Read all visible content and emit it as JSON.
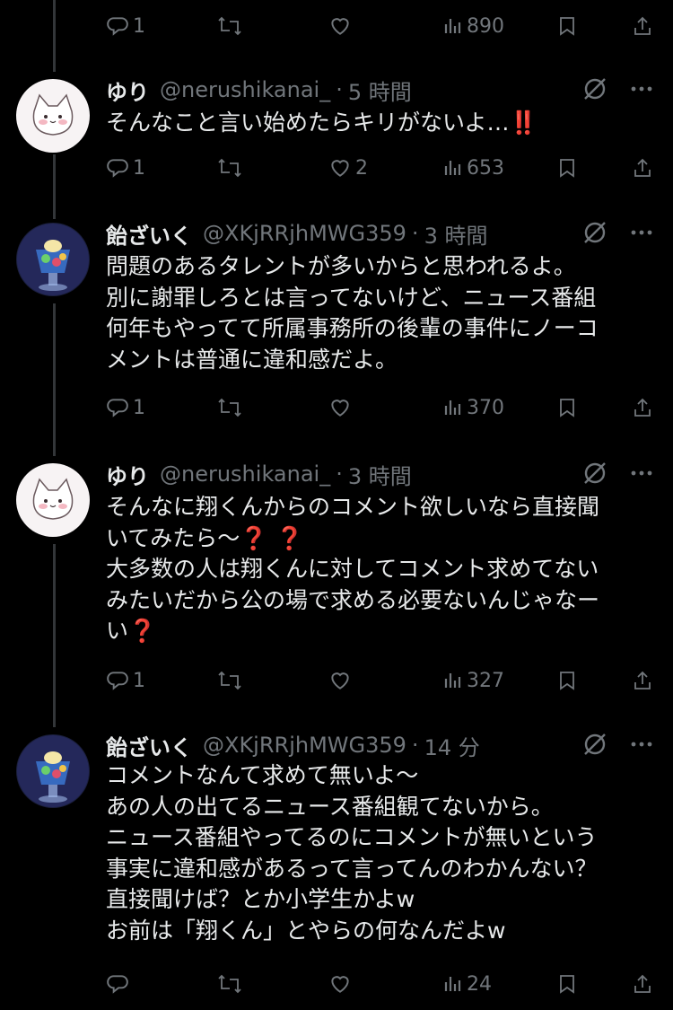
{
  "tweets": [
    {
      "name": "",
      "handle": "",
      "time": "",
      "lines": [],
      "reply_count": "1",
      "retweet_count": "",
      "like_count": "",
      "views": "890"
    },
    {
      "name": "ゆり",
      "handle": "@nerushikanai_",
      "time": "5 時間",
      "lines": [
        "そんなこと言い始めたらキリがないよ…"
      ],
      "emoji_after_line0": "‼️",
      "reply_count": "1",
      "retweet_count": "",
      "like_count": "2",
      "views": "653"
    },
    {
      "name": "飴ざいく",
      "handle": "@XKjRRjhMWG359",
      "time": "3 時間",
      "lines": [
        "問題のあるタレントが多いからと思われるよ。",
        "別に謝罪しろとは言ってないけど、ニュース番組",
        "何年もやってて所属事務所の後輩の事件にノーコ",
        "メントは普通に違和感だよ。"
      ],
      "reply_count": "1",
      "retweet_count": "",
      "like_count": "",
      "views": "370"
    },
    {
      "name": "ゆり",
      "handle": "@nerushikanai_",
      "time": "3 時間",
      "lines": [
        "そんなに翔くんからのコメント欲しいなら直接聞",
        "いてみたら〜",
        "大多数の人は翔くんに対してコメント求めてない",
        "みたいだから公の場で求める必要ないんじゃなー",
        "い"
      ],
      "emoji_line1": "❓ ❓",
      "emoji_line4": "❓",
      "reply_count": "1",
      "retweet_count": "",
      "like_count": "",
      "views": "327"
    },
    {
      "name": "飴ざいく",
      "handle": "@XKjRRjhMWG359",
      "time": "14 分",
      "lines": [
        "コメントなんて求めて無いよ〜",
        "あの人の出てるニュース番組観てないから。",
        "ニュース番組やってるのにコメントが無いという",
        "事実に違和感があるって言ってんのわかんない？",
        "直接聞けば？とか小学生かよw",
        "お前は「翔くん」とやらの何なんだよw"
      ],
      "reply_count": "",
      "retweet_count": "",
      "like_count": "",
      "views": "24"
    }
  ],
  "dot": "·",
  "icons": {
    "reply": "reply-icon",
    "retweet": "retweet-icon",
    "like": "heart-icon",
    "views": "views-icon",
    "bookmark": "bookmark-icon",
    "share": "share-icon",
    "grok": "grok-icon",
    "more": "more-icon"
  },
  "colors": {
    "background": "#000000",
    "text": "#e7e9ea",
    "muted": "#71767b",
    "thread_line": "#333639",
    "emoji_red": "#e5352b"
  }
}
